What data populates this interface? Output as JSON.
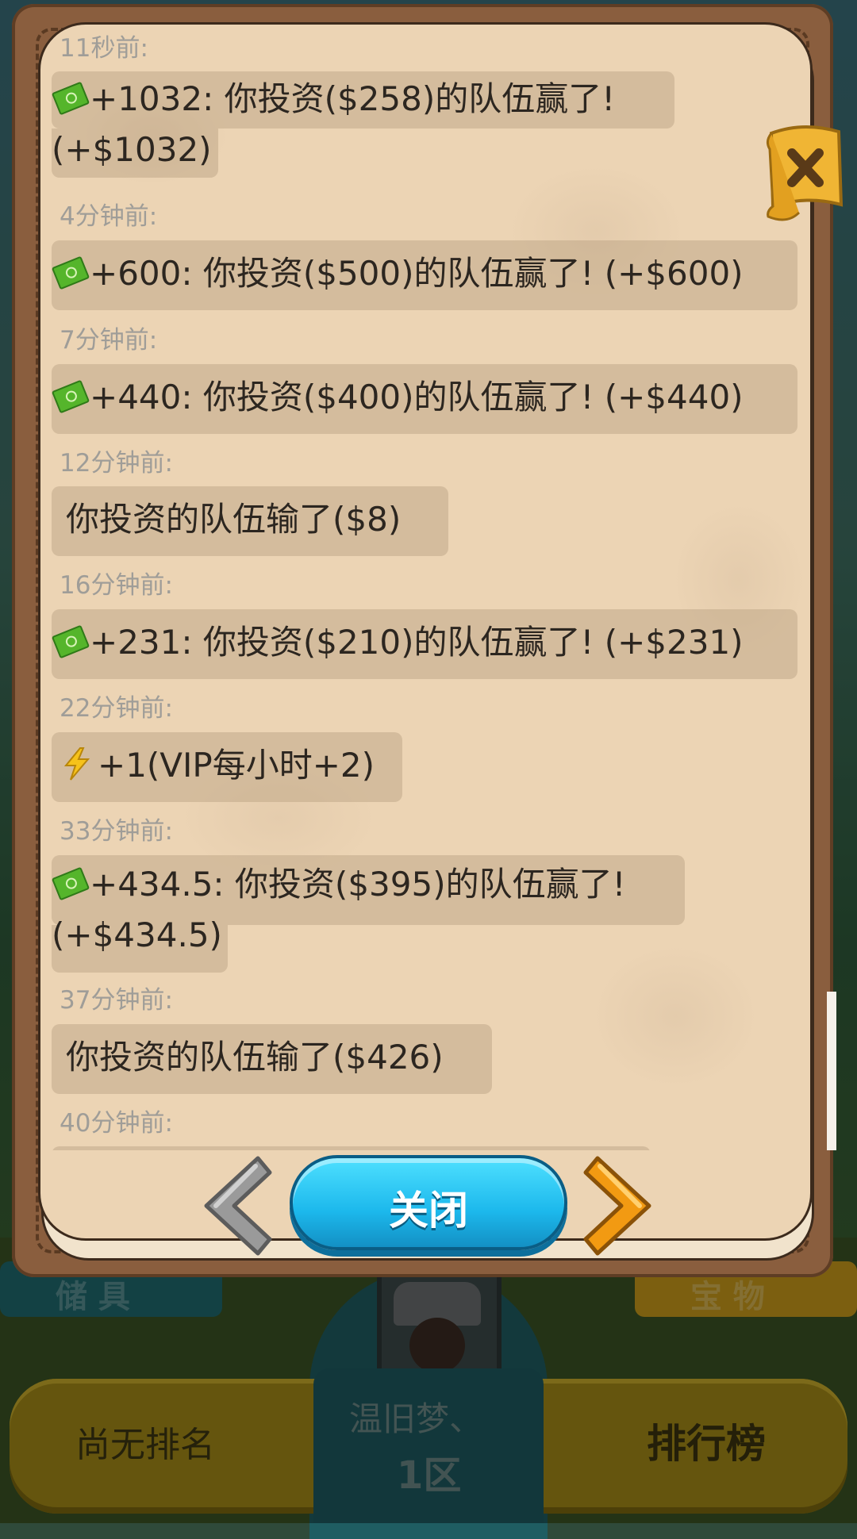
{
  "background": {
    "left_tab_label": "储 具",
    "right_tab_label": "宝 物",
    "rank_status": "尚无排名",
    "leaderboard_label": "排行榜",
    "player_name": "温旧梦、",
    "player_zone": "1区"
  },
  "dialog": {
    "close_button_label": "关闭",
    "entries": [
      {
        "time": "11秒前:",
        "icon": "money-icon",
        "line1": "+1032: 你投资($258)的队伍赢了!",
        "line2": "(+$1032)"
      },
      {
        "time": "4分钟前:",
        "icon": "money-icon",
        "line1": "+600: 你投资($500)的队伍赢了! (+$600)"
      },
      {
        "time": "7分钟前:",
        "icon": "money-icon",
        "line1": "+440: 你投资($400)的队伍赢了! (+$440)"
      },
      {
        "time": "12分钟前:",
        "icon": "",
        "line1": "你投资的队伍输了($8)"
      },
      {
        "time": "16分钟前:",
        "icon": "money-icon",
        "line1": "+231: 你投资($210)的队伍赢了! (+$231)"
      },
      {
        "time": "22分钟前:",
        "icon": "lightning-icon",
        "line1": "+1(VIP每小时+2)"
      },
      {
        "time": "33分钟前:",
        "icon": "money-icon",
        "line1": "+434.5: 你投资($395)的队伍赢了!",
        "line2": "(+$434.5)"
      },
      {
        "time": "37分钟前:",
        "icon": "",
        "line1": "你投资的队伍输了($426)"
      },
      {
        "time": "40分钟前:",
        "icon": "",
        "line1": ""
      }
    ]
  },
  "colors": {
    "button_blue": "#1cb8ec",
    "arrow_orange": "#f29a12",
    "arrow_gray": "#9a9a9a",
    "page_bg": "#ecd4b4",
    "frame_brown": "#8a5e3e"
  }
}
